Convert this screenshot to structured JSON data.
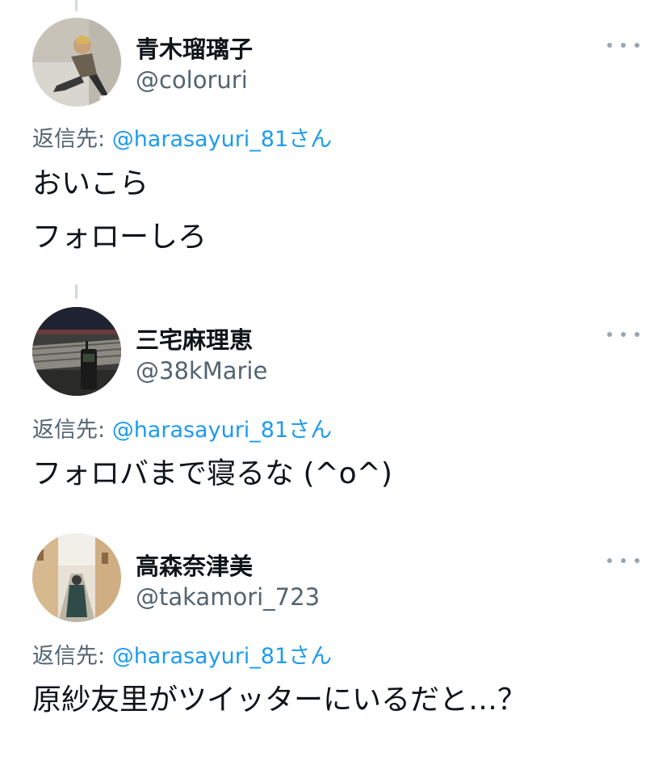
{
  "tweets": [
    {
      "display_name": "青木瑠璃子",
      "handle": "@coloruri",
      "reply_prefix": "返信先: ",
      "reply_mention": "@harasayuri_81",
      "reply_suffix": "さん",
      "text_lines": [
        "おいこら",
        "フォローしろ"
      ],
      "avatar_icon": "user-avatar-photo"
    },
    {
      "display_name": "三宅麻理恵",
      "handle": "@38kMarie",
      "reply_prefix": "返信先: ",
      "reply_mention": "@harasayuri_81",
      "reply_suffix": "さん",
      "text_lines": [
        "フォロバまで寝るな (^o^)"
      ],
      "avatar_icon": "user-avatar-photo"
    },
    {
      "display_name": "高森奈津美",
      "handle": "@takamori_723",
      "reply_prefix": "返信先: ",
      "reply_mention": "@harasayuri_81",
      "reply_suffix": "さん",
      "text_lines": [
        "原紗友里がツイッターにいるだと…？"
      ],
      "avatar_icon": "user-avatar-photo"
    }
  ],
  "colors": {
    "text": "#0f1419",
    "secondary": "#536471",
    "mention": "#1d9bf0",
    "thread_line": "#cfd9de"
  }
}
